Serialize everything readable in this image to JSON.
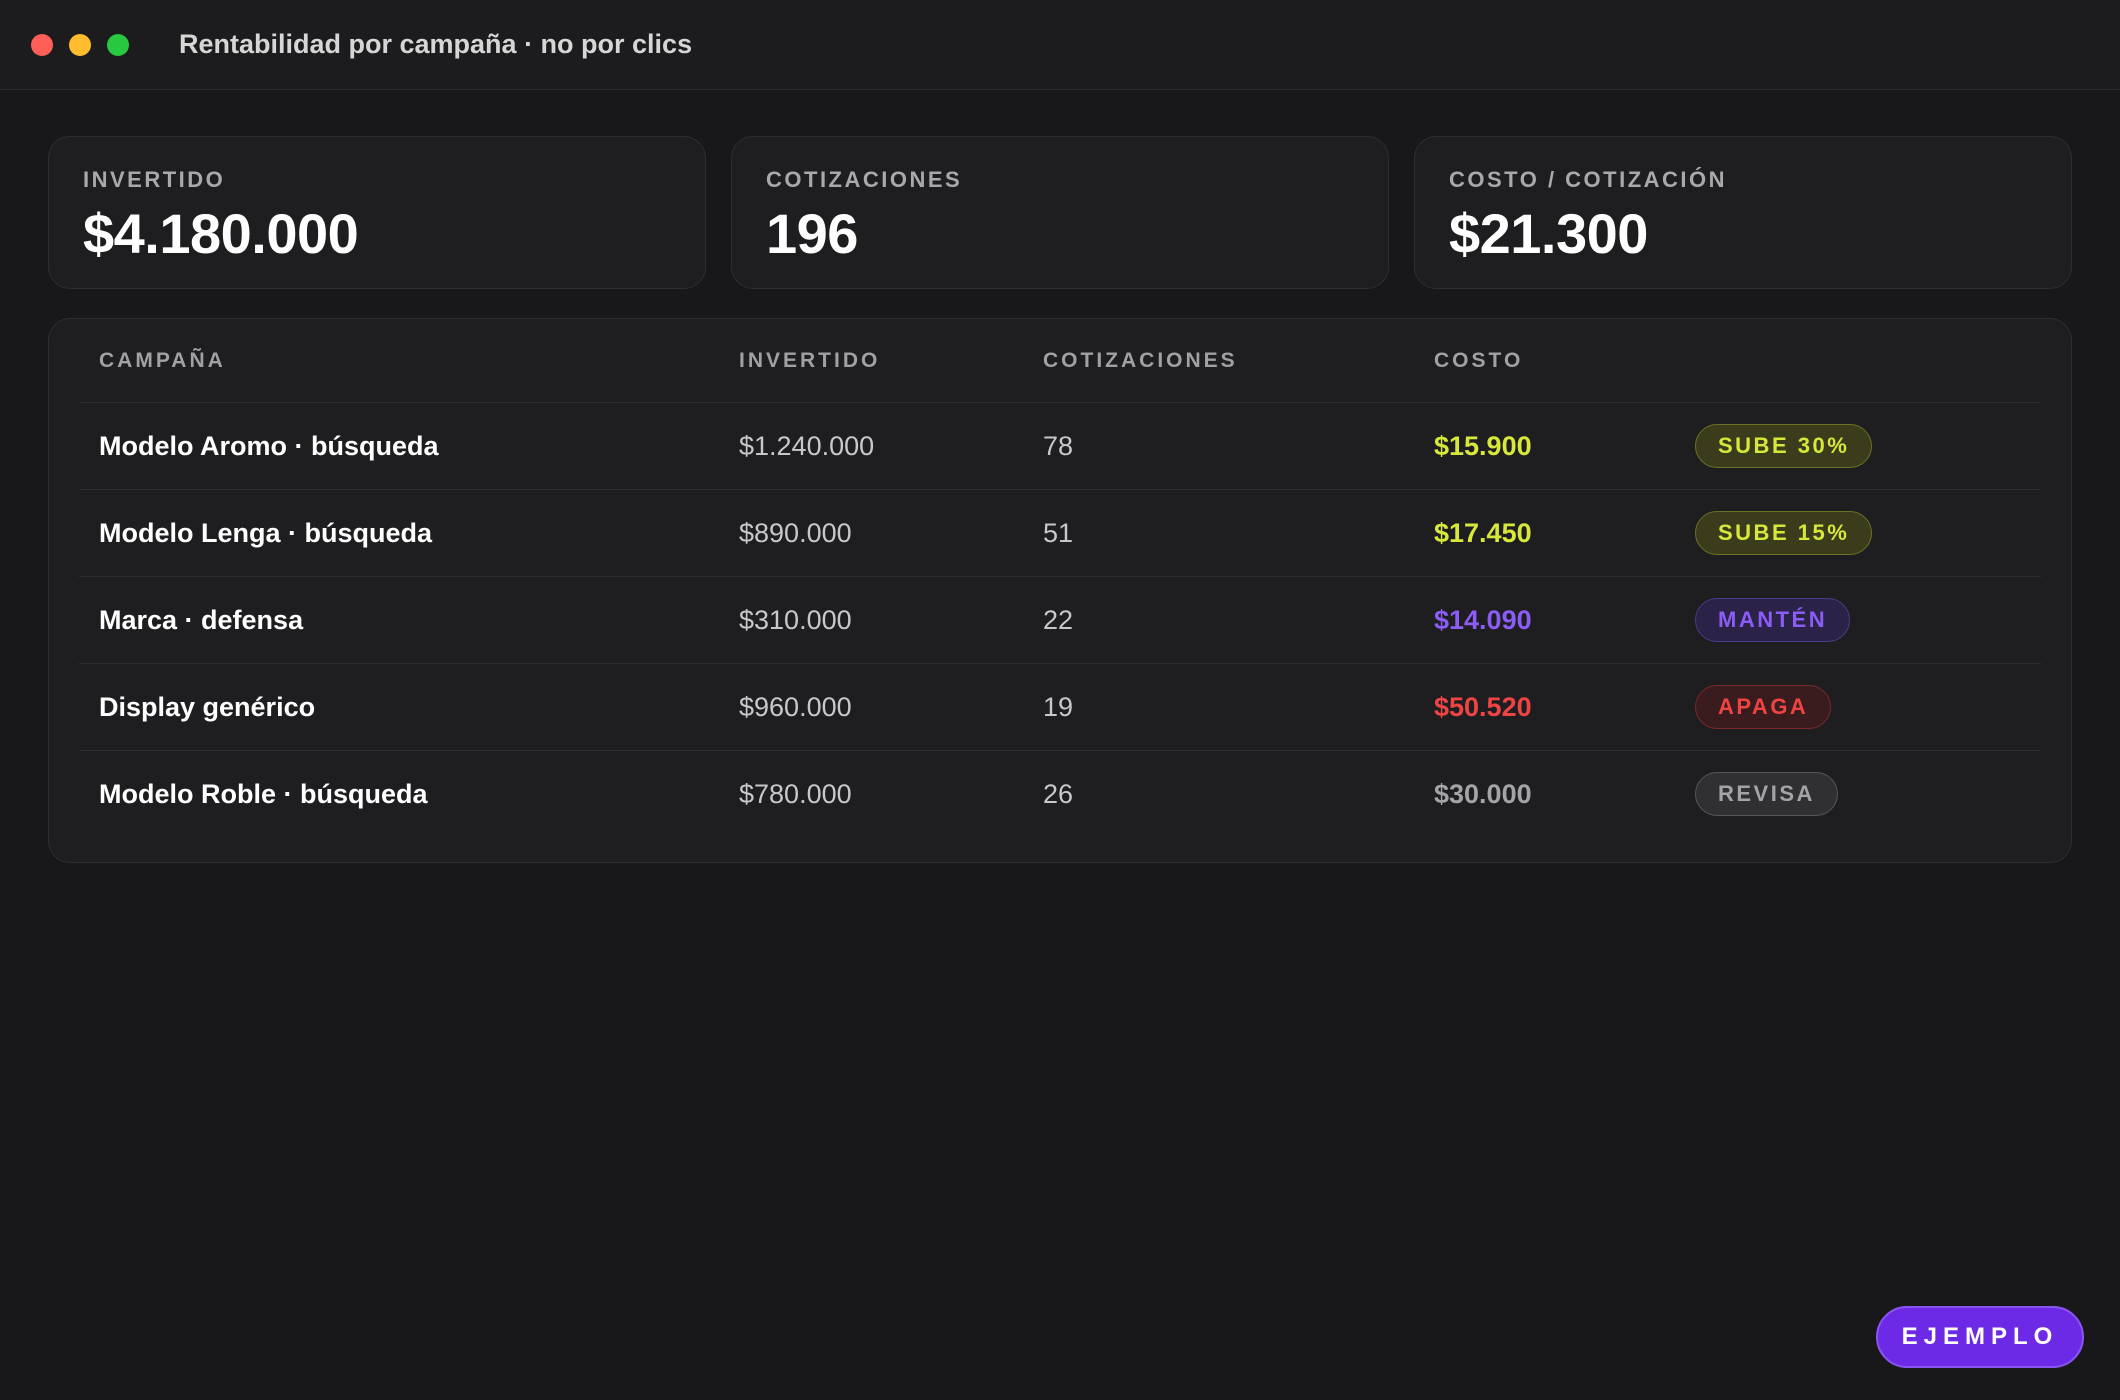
{
  "window": {
    "title": "Rentabilidad por campaña · no por clics",
    "controls": [
      "close-icon",
      "minimize-icon",
      "maximize-icon"
    ]
  },
  "kpis": [
    {
      "label": "INVERTIDO",
      "value": "$4.180.000"
    },
    {
      "label": "COTIZACIONES",
      "value": "196"
    },
    {
      "label": "COSTO / COTIZACIÓN",
      "value": "$21.300"
    }
  ],
  "table": {
    "headers": {
      "campaign": "CAMPAÑA",
      "invested": "INVERTIDO",
      "quotes": "COTIZACIONES",
      "cost": "COSTO"
    },
    "rows": [
      {
        "campaign": "Modelo Aromo · búsqueda",
        "invested": "$1.240.000",
        "quotes": "78",
        "cost": "$15.900",
        "action": "SUBE 30%",
        "tone": "up"
      },
      {
        "campaign": "Modelo Lenga · búsqueda",
        "invested": "$890.000",
        "quotes": "51",
        "cost": "$17.450",
        "action": "SUBE 15%",
        "tone": "up"
      },
      {
        "campaign": "Marca · defensa",
        "invested": "$310.000",
        "quotes": "22",
        "cost": "$14.090",
        "action": "MANTÉN",
        "tone": "keep"
      },
      {
        "campaign": "Display genérico",
        "invested": "$960.000",
        "quotes": "19",
        "cost": "$50.520",
        "action": "APAGA",
        "tone": "off"
      },
      {
        "campaign": "Modelo Roble · búsqueda",
        "invested": "$780.000",
        "quotes": "26",
        "cost": "$30.000",
        "action": "REVISA",
        "tone": "review"
      }
    ]
  },
  "tones": {
    "up": {
      "text": "#d7e83a",
      "bg": "#3a3c1c",
      "border": "#6b7226"
    },
    "keep": {
      "text": "#8b5cf6",
      "bg": "#2b2248",
      "border": "#4c3a86"
    },
    "off": {
      "text": "#ef4444",
      "bg": "#3a1c1e",
      "border": "#7a2a2c"
    },
    "review": {
      "text": "#a3a3a8",
      "bg": "#303033",
      "border": "#55555a"
    }
  },
  "footer": {
    "badge_label": "EJEMPLO",
    "accent": "#6d2ae6"
  }
}
